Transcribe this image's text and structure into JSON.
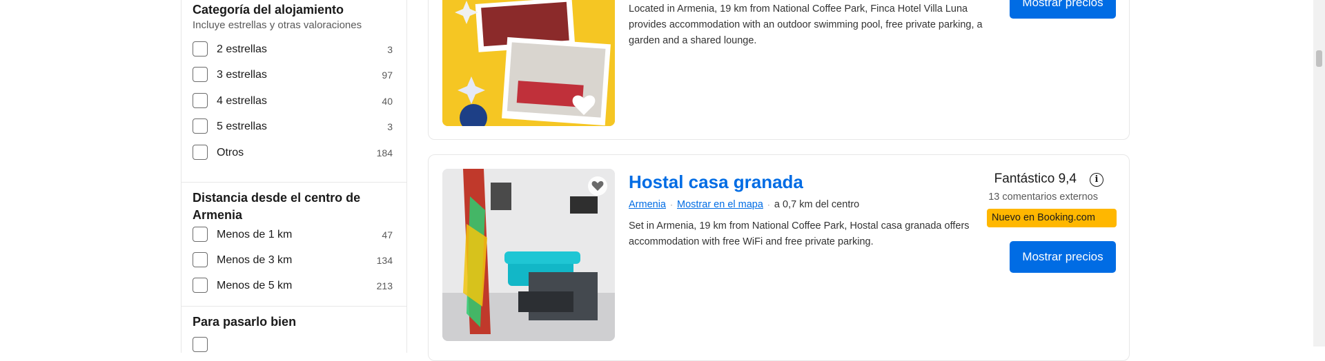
{
  "sidebar": {
    "category": {
      "title": "Categoría del alojamiento",
      "subtitle": "Incluye estrellas y otras valoraciones",
      "options": [
        {
          "label": "2 estrellas",
          "count": "3"
        },
        {
          "label": "3 estrellas",
          "count": "97"
        },
        {
          "label": "4 estrellas",
          "count": "40"
        },
        {
          "label": "5 estrellas",
          "count": "3"
        },
        {
          "label": "Otros",
          "count": "184"
        }
      ]
    },
    "distance": {
      "title": "Distancia desde el centro de Armenia",
      "options": [
        {
          "label": "Menos de 1 km",
          "count": "47"
        },
        {
          "label": "Menos de 3 km",
          "count": "134"
        },
        {
          "label": "Menos de 5 km",
          "count": "213"
        }
      ]
    },
    "fun": {
      "title": "Para pasarlo bien"
    }
  },
  "listings": [
    {
      "description": "Located in Armenia, 19 km from National Coffee Park, Finca Hotel Villa Luna provides accommodation with an outdoor swimming pool, free private parking, a garden and a shared lounge.",
      "button": "Mostrar precios"
    },
    {
      "name": "Hostal casa granada",
      "city": "Armenia",
      "map_link": "Mostrar en el mapa",
      "distance": "a 0,7 km del centro",
      "score_word": "Fantástico 9,4",
      "reviews": "13 comentarios externos",
      "badge": "Nuevo en Booking.com",
      "description": "Set in Armenia, 19 km from National Coffee Park, Hostal casa granada offers accommodation with free WiFi and free private parking.",
      "button": "Mostrar precios"
    }
  ],
  "colors": {
    "brand_blue": "#006ce4",
    "badge_yellow": "#ffb700"
  }
}
